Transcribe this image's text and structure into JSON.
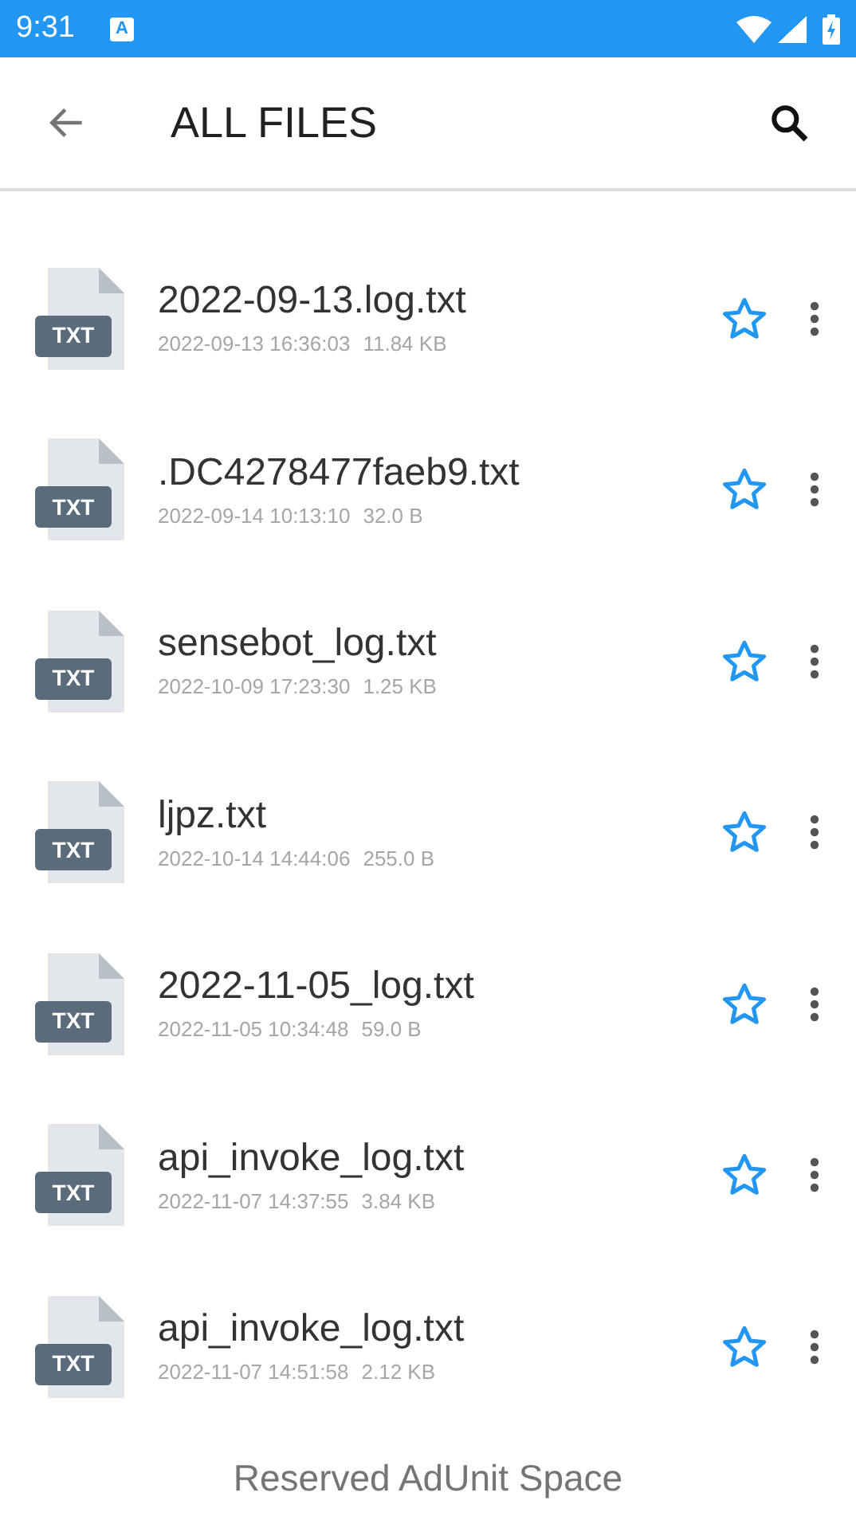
{
  "status_bar": {
    "time": "9:31",
    "notification_glyph": "A"
  },
  "toolbar": {
    "title": "ALL FILES"
  },
  "files": [
    {
      "badge": "TXT",
      "name": "2022-09-13.log.txt",
      "date": "2022-09-13 16:36:03",
      "size": "11.84 KB",
      "starred": false
    },
    {
      "badge": "TXT",
      "name": ".DC4278477faeb9.txt",
      "date": "2022-09-14 10:13:10",
      "size": "32.0 B",
      "starred": false
    },
    {
      "badge": "TXT",
      "name": "sensebot_log.txt",
      "date": "2022-10-09 17:23:30",
      "size": "1.25 KB",
      "starred": false
    },
    {
      "badge": "TXT",
      "name": "ljpz.txt",
      "date": "2022-10-14 14:44:06",
      "size": "255.0 B",
      "starred": false
    },
    {
      "badge": "TXT",
      "name": "2022-11-05_log.txt",
      "date": "2022-11-05 10:34:48",
      "size": "59.0 B",
      "starred": false
    },
    {
      "badge": "TXT",
      "name": "api_invoke_log.txt",
      "date": "2022-11-07 14:37:55",
      "size": "3.84 KB",
      "starred": false
    },
    {
      "badge": "TXT",
      "name": "api_invoke_log.txt",
      "date": "2022-11-07 14:51:58",
      "size": "2.12 KB",
      "starred": false
    }
  ],
  "ad_banner": "Reserved AdUnit Space"
}
